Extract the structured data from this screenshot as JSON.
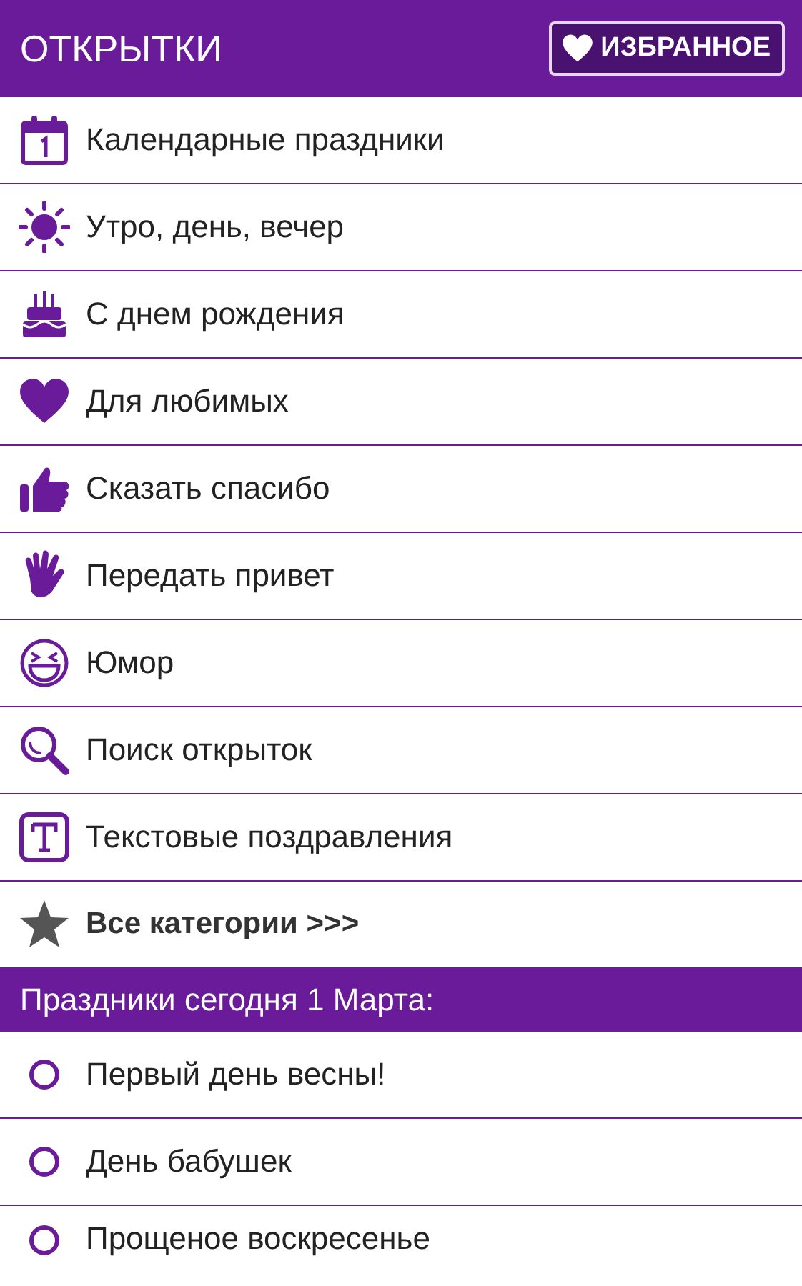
{
  "app_bar": {
    "title": "ОТКРЫТКИ",
    "favorites_button": "ИЗБРАННОЕ"
  },
  "categories": [
    {
      "label": "Календарные праздники",
      "kind": "category"
    },
    {
      "label": "Утро, день, вечер",
      "kind": "category"
    },
    {
      "label": "С днем рождения",
      "kind": "category"
    },
    {
      "label": "Для любимых",
      "kind": "category"
    },
    {
      "label": "Сказать спасибо",
      "kind": "category"
    },
    {
      "label": "Передать привет",
      "kind": "category"
    },
    {
      "label": "Юмор",
      "kind": "category"
    },
    {
      "label": "Поиск открыток",
      "kind": "category"
    },
    {
      "label": "Текстовые поздравления",
      "kind": "category"
    },
    {
      "label": "Все категории >>>",
      "kind": "more"
    }
  ],
  "holidays_section": {
    "title": "Праздники сегодня 1 Марта:",
    "items": [
      "Первый день весны!",
      "День бабушек",
      "Прощеное воскресенье"
    ]
  }
}
